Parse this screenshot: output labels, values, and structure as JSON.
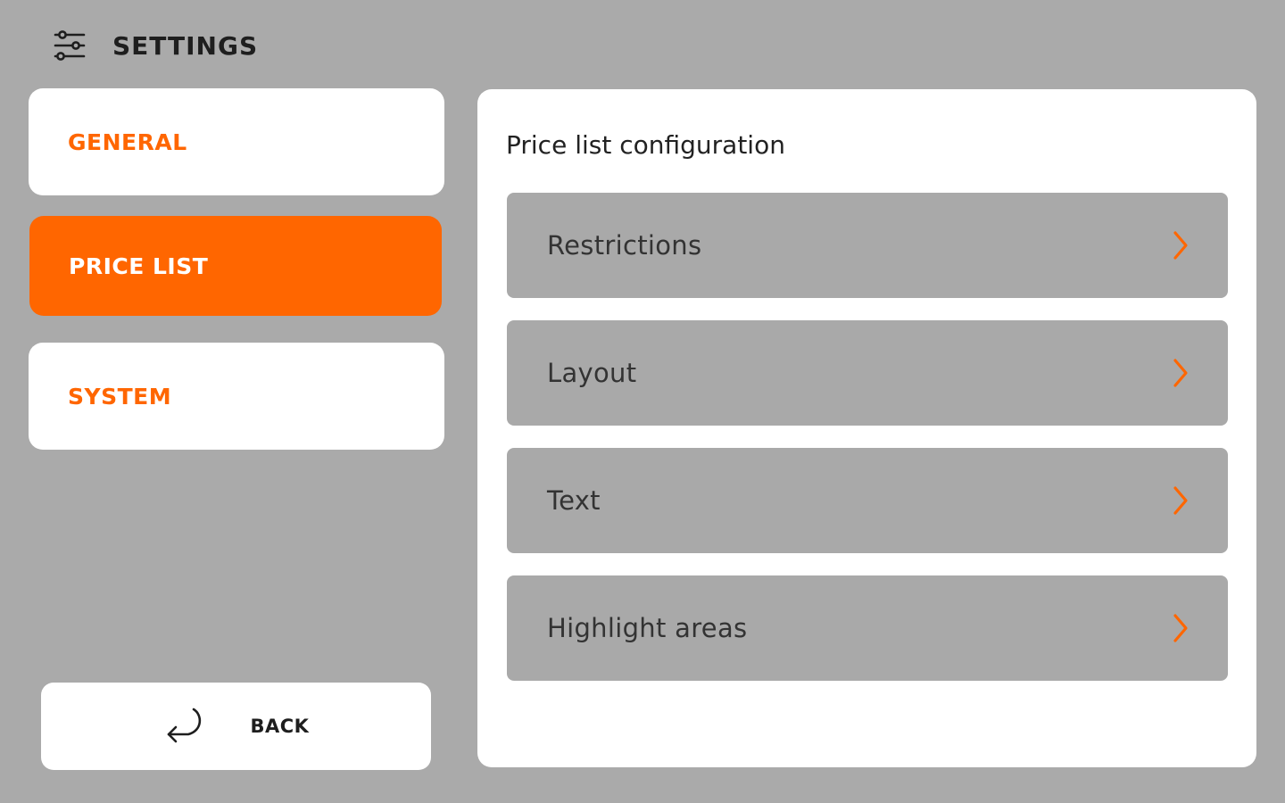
{
  "header": {
    "title": "SETTINGS",
    "icon": "settings-sliders-icon"
  },
  "nav": {
    "items": [
      {
        "label": "GENERAL",
        "active": false
      },
      {
        "label": "PRICE LIST",
        "active": true
      },
      {
        "label": "SYSTEM",
        "active": false
      }
    ],
    "back_label": "BACK",
    "back_icon": "return-arrow-icon"
  },
  "panel": {
    "title": "Price list configuration",
    "items": [
      {
        "label": "Restrictions",
        "icon": "chevron-right-icon"
      },
      {
        "label": "Layout",
        "icon": "chevron-right-icon"
      },
      {
        "label": "Text",
        "icon": "chevron-right-icon"
      },
      {
        "label": "Highlight areas",
        "icon": "chevron-right-icon"
      }
    ]
  },
  "colors": {
    "background": "#aaaaaa",
    "accent": "#ff6600",
    "card": "#ffffff",
    "item": "#a9a9a9"
  }
}
